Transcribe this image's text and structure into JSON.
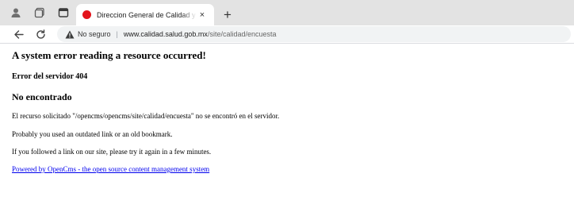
{
  "browser": {
    "tab": {
      "title": "Direccion General de Calidad y Educación en Salud",
      "close_glyph": "×"
    },
    "new_tab_glyph": "+",
    "address_bar": {
      "security_label": "No seguro",
      "separator": "|",
      "url_host": "www.calidad.salud.gob.mx",
      "url_path": "/site/calidad/encuesta"
    },
    "icons": [
      "profile-icon",
      "workspaces-icon",
      "tab-actions-icon",
      "back-icon",
      "reload-icon",
      "warning-icon"
    ],
    "favicon_color": "#e3131b"
  },
  "page": {
    "heading": "A system error reading a resource occurred!",
    "error_code": "Error del servidor 404",
    "not_found": "No encontrado",
    "message": "El recurso solicitado \"/opencms/opencms/site/calidad/encuesta\" no se encontró en el servidor.",
    "hint1": "Probably you used an outdated link or an old bookmark.",
    "hint2": "If you followed a link on our site, please try it again in a few minutes.",
    "footer_link": "Powered by OpenCms - the open source content management system",
    "link_color": "#0000ee"
  }
}
